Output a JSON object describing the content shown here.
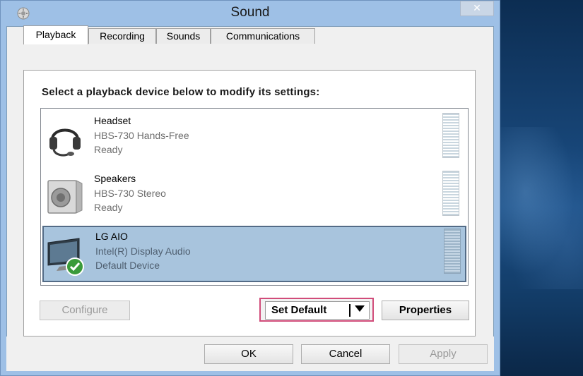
{
  "window": {
    "title": "Sound",
    "close_symbol": "✕"
  },
  "tabs": [
    {
      "label": "Playback",
      "active": true
    },
    {
      "label": "Recording",
      "active": false
    },
    {
      "label": "Sounds",
      "active": false
    },
    {
      "label": "Communications",
      "active": false
    }
  ],
  "panel": {
    "instruction": "Select a playback device below to modify its settings:"
  },
  "devices": [
    {
      "name": "Headset",
      "description": "HBS-730 Hands-Free",
      "status": "Ready",
      "icon": "headset-icon",
      "selected": false
    },
    {
      "name": "Speakers",
      "description": "HBS-730 Stereo",
      "status": "Ready",
      "icon": "speaker-icon",
      "selected": false
    },
    {
      "name": "LG AIO",
      "description": "Intel(R) Display Audio",
      "status": "Default Device",
      "icon": "monitor-icon",
      "selected": true
    }
  ],
  "buttons": {
    "configure": "Configure",
    "set_default": "Set Default",
    "properties": "Properties",
    "ok": "OK",
    "cancel": "Cancel",
    "apply": "Apply"
  },
  "colors": {
    "selection": "#a8c4dd",
    "highlight_frame": "#d14c7a",
    "default_check": "#3a9a3a"
  }
}
